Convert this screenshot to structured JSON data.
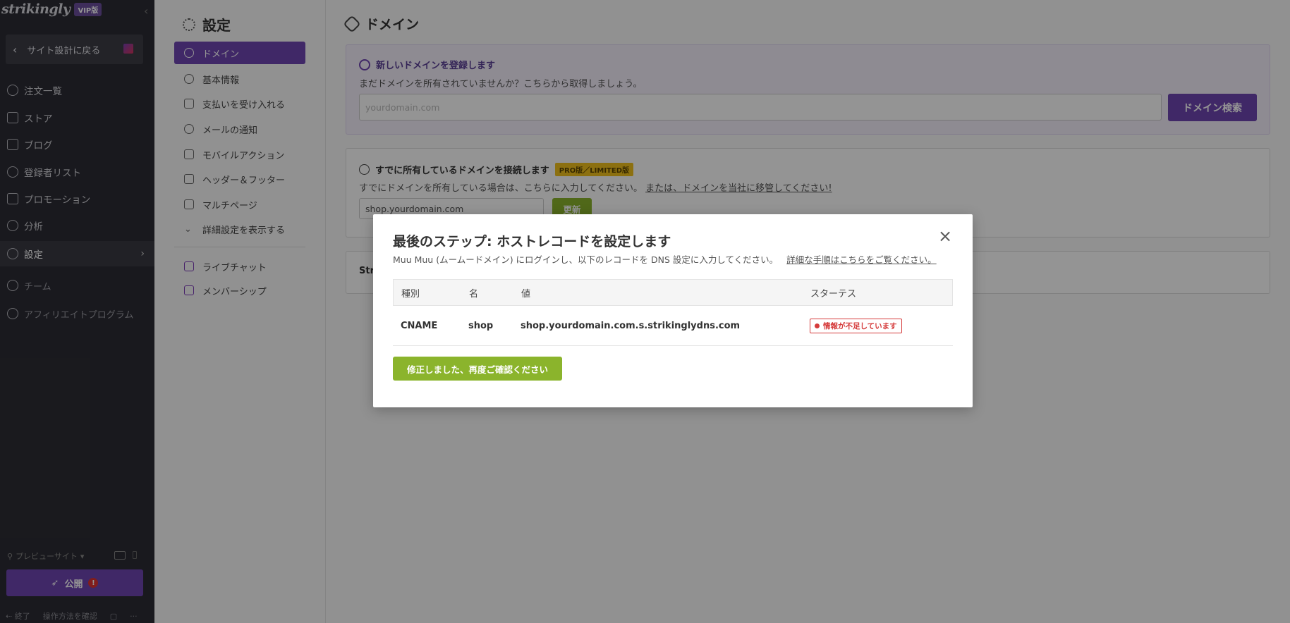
{
  "sidebar": {
    "brand": "strikingly",
    "vip": "VIP版",
    "back_label": "サイト設計に戻る",
    "items": [
      {
        "label": "注文一覧"
      },
      {
        "label": "ストア"
      },
      {
        "label": "ブログ"
      },
      {
        "label": "登録者リスト"
      },
      {
        "label": "プロモーション"
      },
      {
        "label": "分析"
      },
      {
        "label": "設定"
      },
      {
        "label": "チーム"
      },
      {
        "label": "アフィリエイトプログラム"
      }
    ],
    "preview_label": "プレビューサイト",
    "publish_label": "公開",
    "publish_alert": "!",
    "footer": {
      "exit": "終了",
      "howto": "操作方法を確認",
      "more": "···"
    }
  },
  "settings": {
    "title": "設定",
    "items": [
      {
        "label": "ドメイン"
      },
      {
        "label": "基本情報"
      },
      {
        "label": "支払いを受け入れる"
      },
      {
        "label": "メールの通知"
      },
      {
        "label": "モバイルアクション"
      },
      {
        "label": "ヘッダー＆フッター"
      },
      {
        "label": "マルチページ"
      },
      {
        "label": "詳細設定を表示する"
      },
      {
        "label": "ライブチャット"
      },
      {
        "label": "メンバーシップ"
      }
    ]
  },
  "main": {
    "title": "ドメイン",
    "register": {
      "heading": "新しいドメインを登録します",
      "sub": "まだドメインを所有されていませんか？こちらから取得しましょう。",
      "placeholder": "yourdomain.com",
      "button": "ドメイン検索"
    },
    "connect": {
      "heading": "すでに所有しているドメインを接続します",
      "badge": "PRO版／LIMITED版",
      "sub": "すでにドメインを所有している場合は、こちらに入力してください。",
      "link": "または、ドメインを当社に移管してください!",
      "value": "shop.yourdomain.com",
      "button": "更新"
    },
    "third_card_text": "Str"
  },
  "modal": {
    "title": "最後のステップ: ホストレコードを設定します",
    "desc": "Muu Muu (ムームードメイン) にログインし、以下のレコードを DNS 設定に入力してください。",
    "desc_link": "詳細な手順はこちらをご覧ください。",
    "columns": {
      "type": "種別",
      "name": "名",
      "value": "値",
      "status": "スターテス"
    },
    "row": {
      "type": "CNAME",
      "name": "shop",
      "value": "shop.yourdomain.com.s.strikinglydns.com",
      "status": "情報が不足しています"
    },
    "confirm_button": "修正しました、再度ご確認ください",
    "close": "×"
  }
}
